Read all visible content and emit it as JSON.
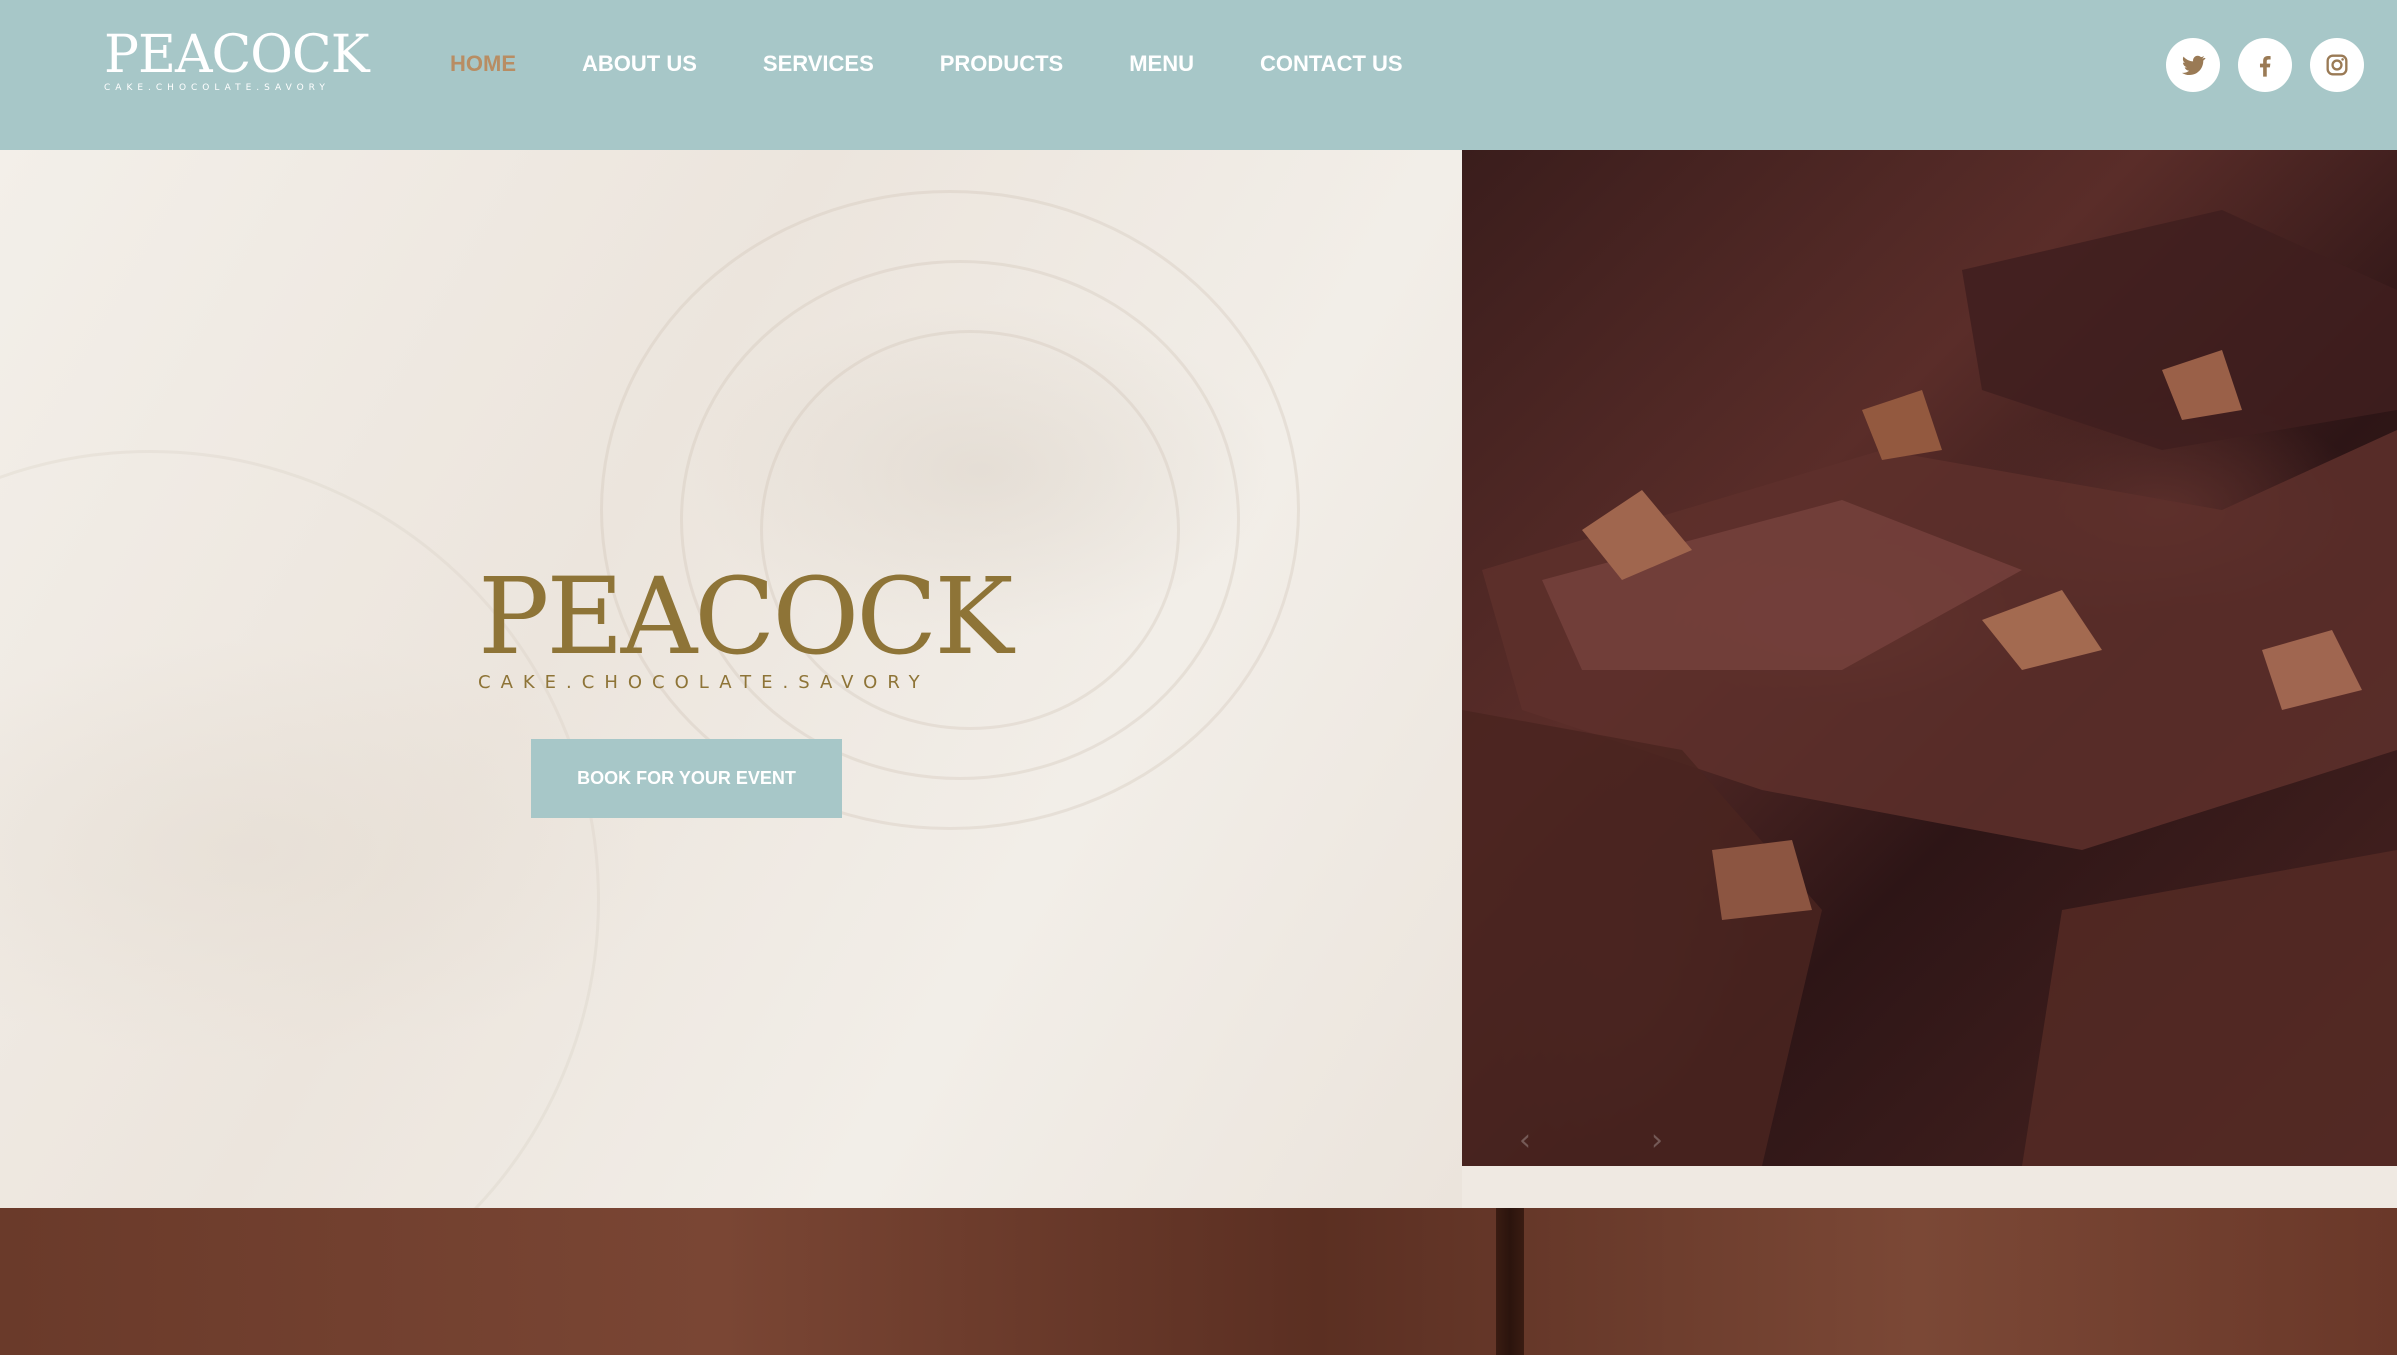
{
  "header": {
    "logo": {
      "word": "PEACOCK",
      "tagline": "CAKE.CHOCOLATE.SAVORY"
    },
    "nav": [
      {
        "label": "HOME",
        "active": true
      },
      {
        "label": "ABOUT US",
        "active": false
      },
      {
        "label": "SERVICES",
        "active": false
      },
      {
        "label": "PRODUCTS",
        "active": false
      },
      {
        "label": "MENU",
        "active": false
      },
      {
        "label": "CONTACT US",
        "active": false
      }
    ],
    "social": [
      {
        "icon": "twitter-icon"
      },
      {
        "icon": "facebook-icon"
      },
      {
        "icon": "instagram-icon"
      }
    ]
  },
  "hero": {
    "logo": {
      "word": "PEACOCK",
      "tagline": "CAKE.CHOCOLATE.SAVORY"
    },
    "cta_label": "BOOK FOR YOUR EVENT",
    "slider": {
      "prev_icon": "chevron-left-icon",
      "next_icon": "chevron-right-icon"
    }
  },
  "colors": {
    "header_bg": "#a7c7c8",
    "nav_text": "#ffffff",
    "nav_active": "#b88d63",
    "logo_gold": "#8e7437",
    "cta_bg": "#a7c7c8",
    "hero_bg": "#efe9e2"
  }
}
